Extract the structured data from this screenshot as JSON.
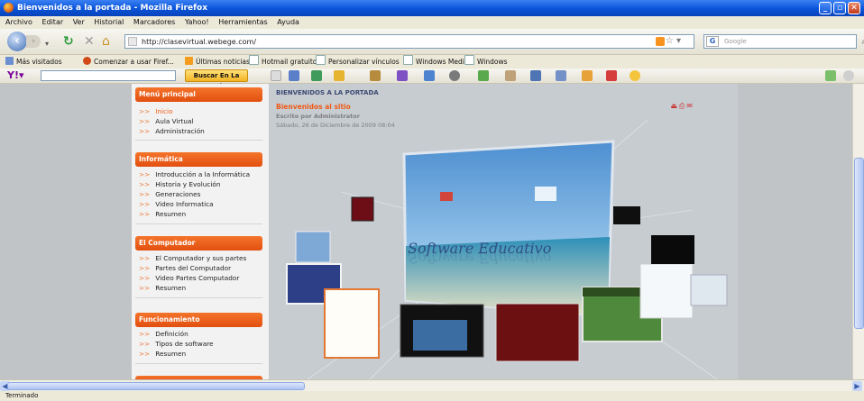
{
  "window": {
    "title": "Bienvenidos a la portada - Mozilla Firefox"
  },
  "menubar": [
    "Archivo",
    "Editar",
    "Ver",
    "Historial",
    "Marcadores",
    "Yahoo!",
    "Herramientas",
    "Ayuda"
  ],
  "navbar": {
    "url": "http://clasevirtual.webege.com/",
    "search_placeholder": "Google"
  },
  "bookmarks": [
    "Más visitados",
    "Comenzar a usar Firef...",
    "Últimas noticias",
    "Hotmail gratuito",
    "Personalizar vínculos",
    "Windows Media",
    "Windows"
  ],
  "yahoo_toolbar": {
    "search_button": "Buscar En La Web"
  },
  "sidebar": {
    "sections": [
      {
        "title": "Menú principal",
        "items": [
          "Inicio",
          "Aula Virtual",
          "Administración"
        ]
      },
      {
        "title": "Informática",
        "items": [
          "Introducción a la Informática",
          "Historia y Evolución",
          "Generaciones",
          "Video Informatica",
          "Resumen"
        ]
      },
      {
        "title": "El Computador",
        "items": [
          "El Computador y sus partes",
          "Partes del Computador",
          "Video Partes Computador",
          "Resumen"
        ]
      },
      {
        "title": "Funcionamiento",
        "items": [
          "Definición",
          "Tipos de software",
          "Resumen"
        ]
      }
    ]
  },
  "main": {
    "heading": "BIENVENIDOS A LA PORTADA",
    "article_title": "Bienvenidos al sitio",
    "author": "Escrito por Administrator",
    "date": "Sábado, 26 de Diciembre de 2009 08:04",
    "hero_text": "Software Educativo"
  },
  "status": {
    "text": "Terminado"
  },
  "colors": {
    "accent": "#e85a16",
    "titlebar": "#0a53d8",
    "content_bg": "#c7ccd1"
  }
}
